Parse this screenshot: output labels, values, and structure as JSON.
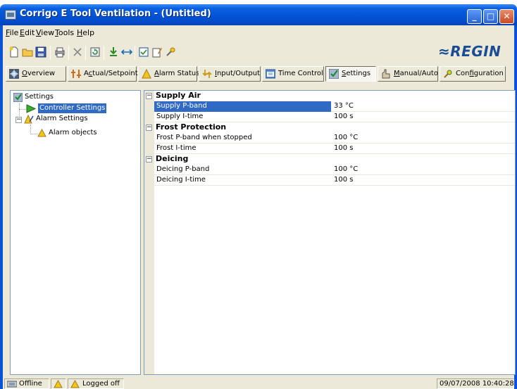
{
  "window": {
    "title": "Corrigo E Tool Ventilation - (Untitled)",
    "min_glyph": "_",
    "max_glyph": "□",
    "close_glyph": "✕"
  },
  "menu": {
    "file": {
      "u": "F",
      "rest": "ile"
    },
    "edit": {
      "u": "E",
      "rest": "dit"
    },
    "view": {
      "u": "V",
      "rest": "iew"
    },
    "tools": {
      "u": "T",
      "rest": "ools"
    },
    "help": {
      "u": "H",
      "rest": "elp"
    }
  },
  "brand": {
    "logo_text": "≈REGIN",
    "color": "#1a4d95"
  },
  "tabs": [
    {
      "pre": "",
      "u": "O",
      "rest": "verview",
      "icon": "overview-icon"
    },
    {
      "pre": "A",
      "u": "c",
      "rest": "tual/Setpoint",
      "icon": "setpoint-icon"
    },
    {
      "pre": "",
      "u": "A",
      "rest": "larm Status",
      "icon": "alarm-icon"
    },
    {
      "pre": "",
      "u": "I",
      "rest": "nput/Output",
      "icon": "io-icon"
    },
    {
      "pre": "Time Control",
      "u": "",
      "rest": "",
      "icon": "clock-icon"
    },
    {
      "pre": "",
      "u": "S",
      "rest": "ettings",
      "icon": "settings-icon"
    },
    {
      "pre": "",
      "u": "M",
      "rest": "anual/Auto",
      "icon": "manual-icon"
    },
    {
      "pre": "Con",
      "u": "f",
      "rest": "iguration",
      "icon": "configuration-icon"
    }
  ],
  "active_tab": "Settings",
  "tree": {
    "root": "Settings",
    "controller": "Controller Settings",
    "alarm_settings": "Alarm Settings",
    "alarm_objects": "Alarm objects",
    "expander_glyph": "−"
  },
  "grid": {
    "collapse_glyph": "−",
    "categories": [
      {
        "label": "Supply Air",
        "rows": [
          {
            "name": "Supply P-band",
            "value": "33 °C",
            "selected": true
          },
          {
            "name": "Supply I-time",
            "value": "100 s",
            "selected": false
          }
        ]
      },
      {
        "label": "Frost Protection",
        "rows": [
          {
            "name": "Frost P-band when stopped",
            "value": "100 °C",
            "selected": false
          },
          {
            "name": "Frost I-time",
            "value": "100 s",
            "selected": false
          }
        ]
      },
      {
        "label": "Deicing",
        "rows": [
          {
            "name": "Deicing P-band",
            "value": "100 °C",
            "selected": false
          },
          {
            "name": "Deicing I-time",
            "value": "100 s",
            "selected": false
          }
        ]
      }
    ]
  },
  "status": {
    "connection": "Offline",
    "login": "Logged off",
    "datetime": "09/07/2008 10:40:28"
  }
}
